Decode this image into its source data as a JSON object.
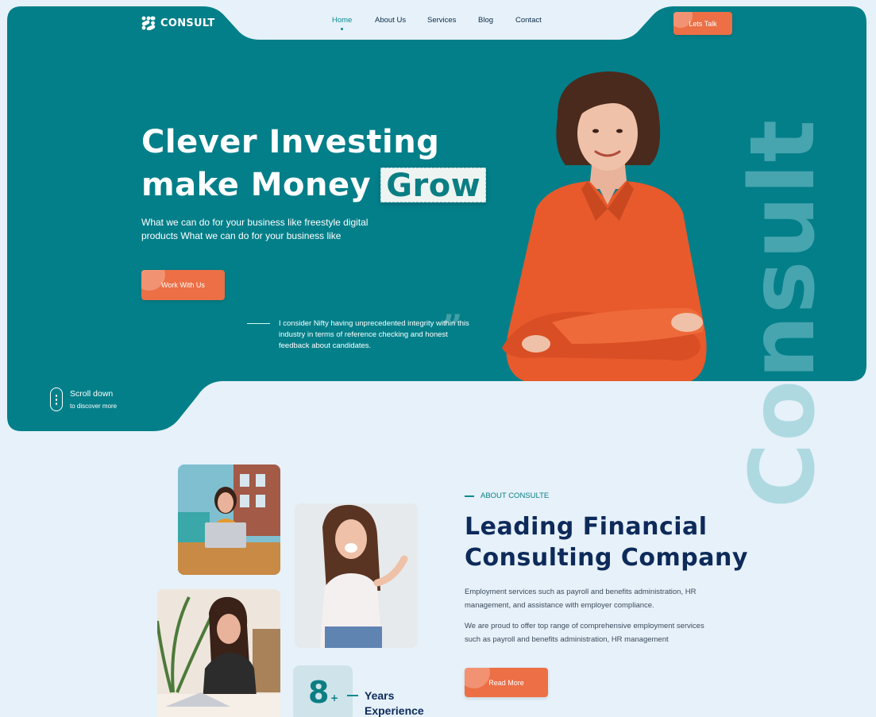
{
  "brand": {
    "name": "CONSULT"
  },
  "nav": {
    "items": [
      {
        "label": "Home",
        "active": true
      },
      {
        "label": "About Us",
        "active": false
      },
      {
        "label": "Services",
        "active": false
      },
      {
        "label": "Blog",
        "active": false
      },
      {
        "label": "Contact",
        "active": false
      }
    ],
    "cta_label": "Lets Talk"
  },
  "hero": {
    "title_line1": "Clever Investing",
    "title_line2": "make Money",
    "title_highlight": "Grow",
    "subtitle": "What we can do for your business like freestyle digital products What we can do for your business like",
    "cta_label": "Work With Us",
    "quote": "I consider Nifty having unprecedented integrity within this industry in terms of reference checking and honest feedback about candidates.",
    "quote_mark": "”",
    "scroll_title": "Scroll down",
    "scroll_sub": "to discover more",
    "watermark": "Consult"
  },
  "about": {
    "eyebrow": "ABOUT CONSULTE",
    "title_line1": "Leading Financial",
    "title_line2": "Consulting Company",
    "para1": "Employment services such as payroll and benefits administration, HR management, and assistance with employer compliance.",
    "para2": "We are proud to offer top range of comprehensive employment services such as payroll and benefits administration, HR management",
    "cta_label": "Read More",
    "years_number": "8",
    "years_plus": "+",
    "years_line1": "Years",
    "years_line2": "Experience"
  },
  "colors": {
    "teal": "#0b8a8f",
    "orange": "#ec6f45",
    "navy": "#0d2a5a",
    "background": "#e6f1f9"
  },
  "icons": [
    "logo-mark-icon",
    "mouse-scroll-icon",
    "quote-icon"
  ]
}
